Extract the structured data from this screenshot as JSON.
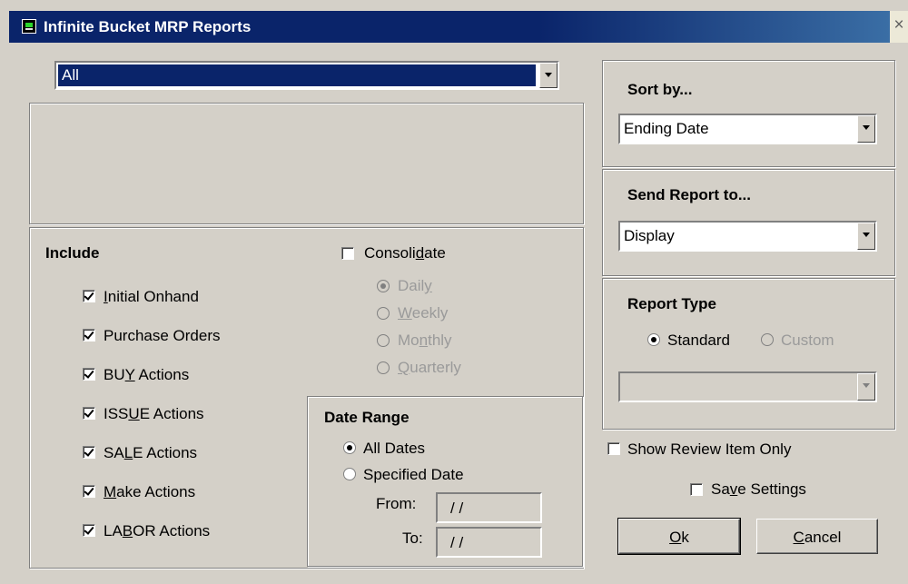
{
  "window": {
    "title": "Infinite Bucket MRP Reports",
    "close_glyph": "×"
  },
  "filter": {
    "selected": "All"
  },
  "include": {
    "heading": "Include",
    "items": [
      {
        "label": "Initial Onhand",
        "checked": true
      },
      {
        "label": "Purchase Orders",
        "checked": true
      },
      {
        "label": "BUY Actions",
        "checked": true
      },
      {
        "label": "ISSUE Actions",
        "checked": true
      },
      {
        "label": "SALE Actions",
        "checked": true
      },
      {
        "label": "Make Actions",
        "checked": true
      },
      {
        "label": "LABOR Actions",
        "checked": true
      }
    ]
  },
  "consolidate": {
    "label": "Consolidate",
    "checked": false,
    "options": [
      "Daily",
      "Weekly",
      "Monthly",
      "Quarterly"
    ],
    "selected": "Daily"
  },
  "date_range": {
    "heading": "Date Range",
    "options": [
      "All Dates",
      "Specified Date"
    ],
    "selected": "All Dates",
    "from_label": "From:",
    "from_value": "/ /",
    "to_label": "To:",
    "to_value": "/ /"
  },
  "sort": {
    "heading": "Sort by...",
    "selected": "Ending Date"
  },
  "send": {
    "heading": "Send Report to...",
    "selected": "Display"
  },
  "report_type": {
    "heading": "Report Type",
    "options": [
      "Standard",
      "Custom"
    ],
    "selected": "Standard",
    "custom_selected": ""
  },
  "show_review": {
    "label": "Show Review Item Only",
    "checked": false
  },
  "save_settings": {
    "label": "Save Settings",
    "checked": false
  },
  "buttons": {
    "ok": "Ok",
    "cancel": "Cancel"
  },
  "colors": {
    "titlebar": "#0a246a",
    "face": "#d4d0c8",
    "selection": "#0a246a"
  },
  "icons": [
    "app-icon",
    "close-icon",
    "chevron-down-icon",
    "checkbox-icon",
    "radio-icon"
  ]
}
